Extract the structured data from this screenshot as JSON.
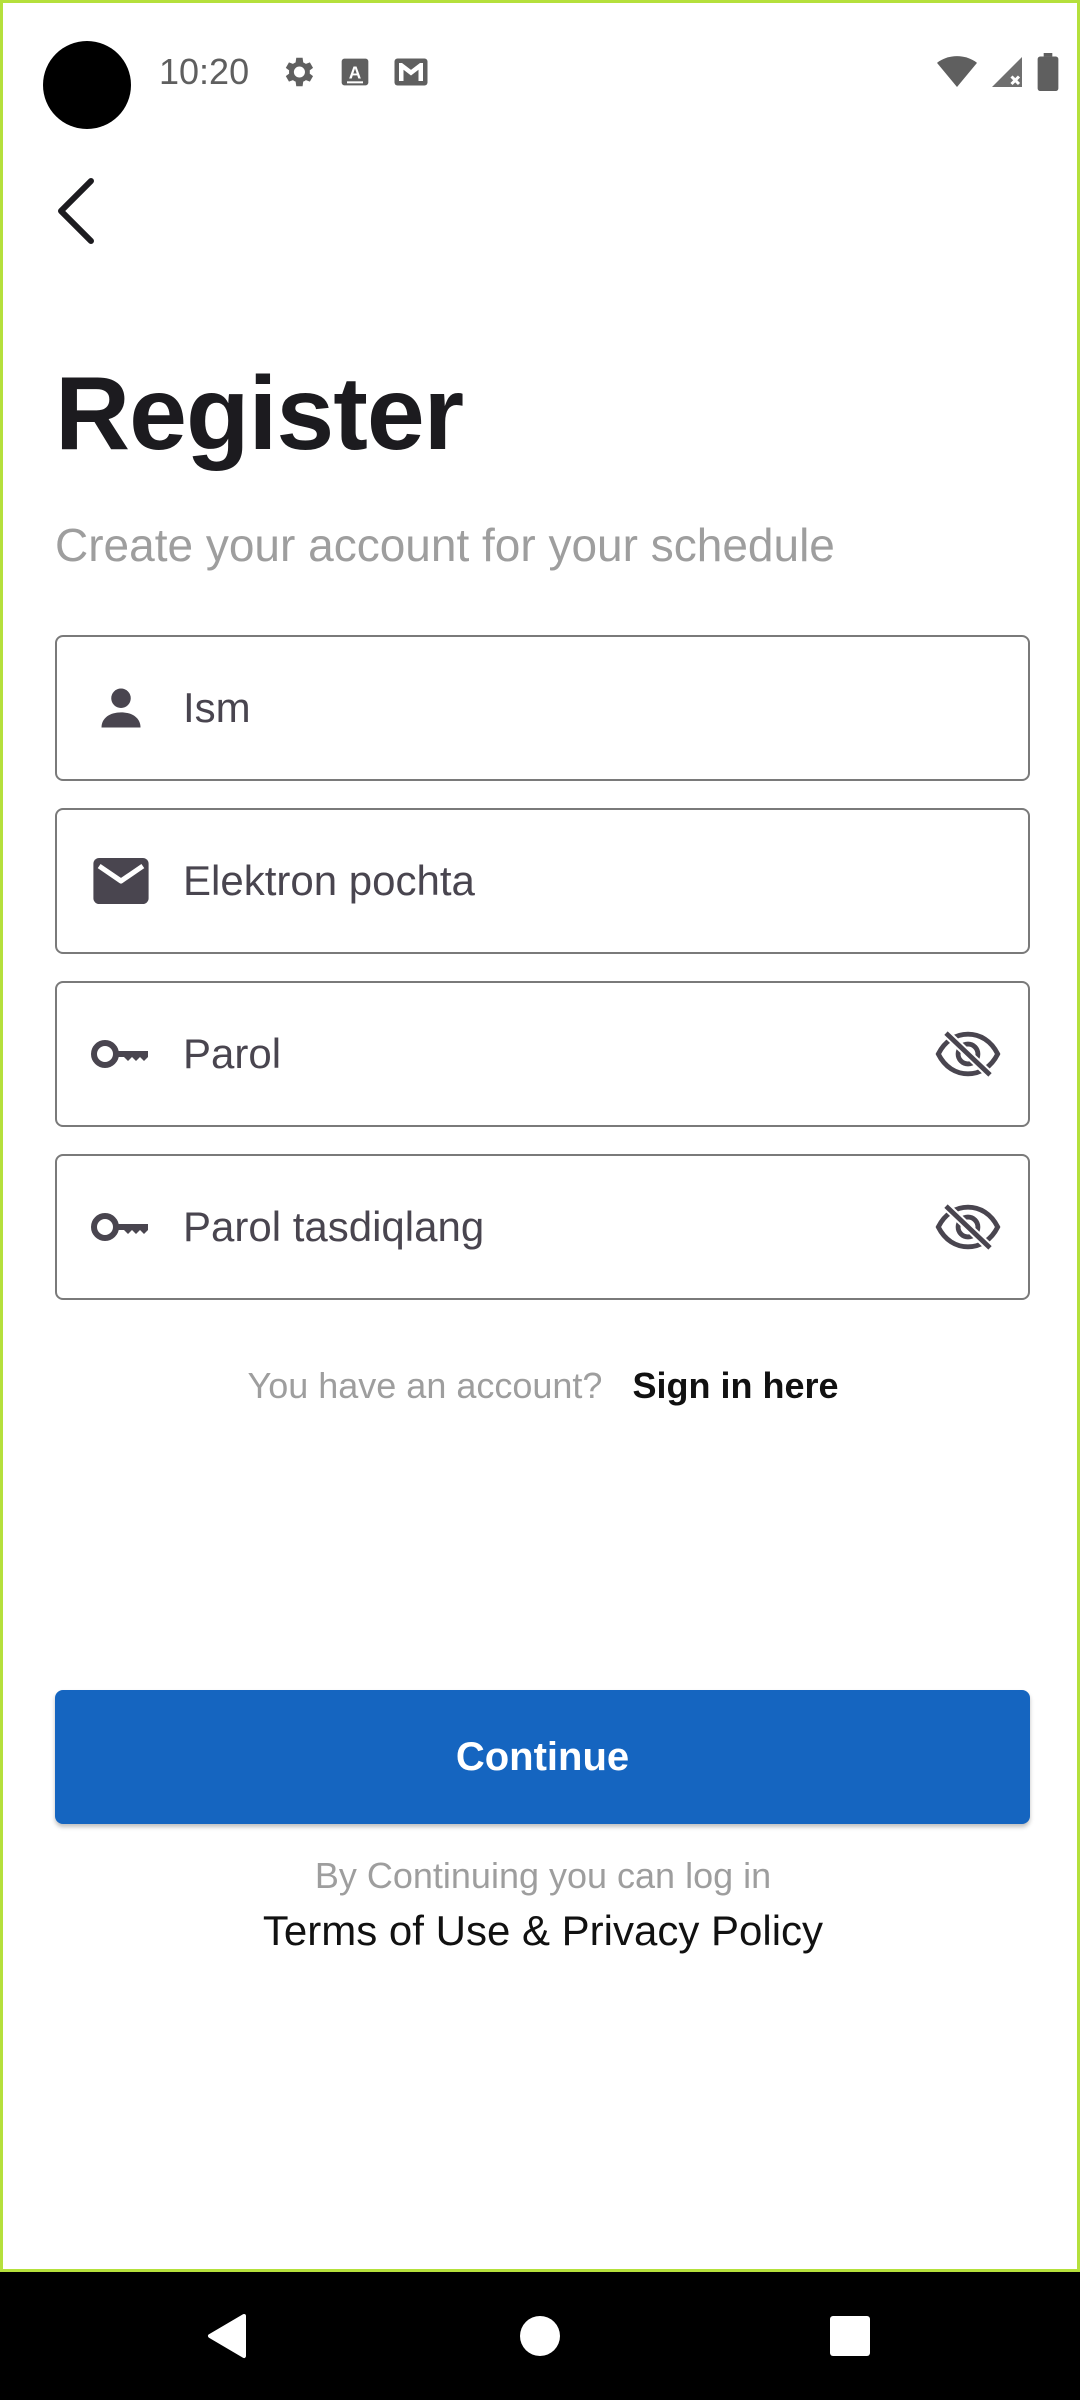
{
  "status_bar": {
    "time": "10:20",
    "left_icons": [
      "settings-icon",
      "text-a-icon",
      "gmail-icon"
    ],
    "right_icons": [
      "wifi-icon",
      "signal-icon",
      "battery-icon"
    ]
  },
  "header": {
    "back_icon": "arrow-back-icon",
    "title": "Register",
    "subtitle": "Create your account for your schedule"
  },
  "form": {
    "name_placeholder": "Ism",
    "email_placeholder": "Elektron pochta",
    "password_placeholder": "Parol",
    "confirm_placeholder": "Parol tasdiqlang"
  },
  "signin": {
    "prompt": "You have an account?",
    "link": "Sign in here"
  },
  "continue_label": "Continue",
  "footer": {
    "note": "By Continuing you can log in",
    "link": "Terms of Use & Privacy Policy"
  },
  "colors": {
    "accent": "#1565c0",
    "frame": "#b5e03c",
    "muted_text": "#9e9e9e"
  }
}
